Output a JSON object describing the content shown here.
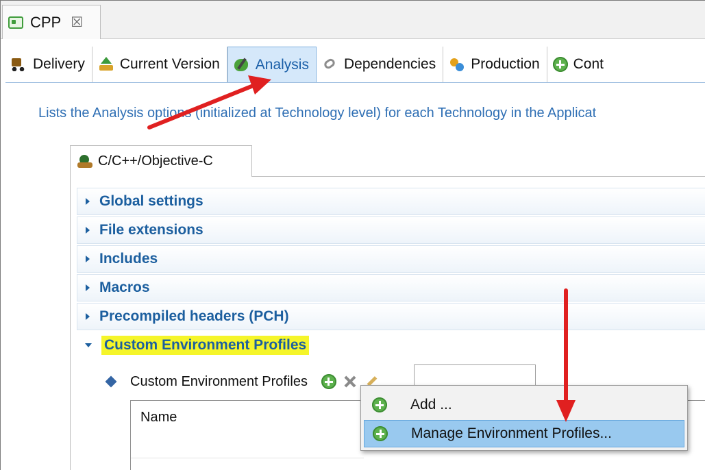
{
  "editor": {
    "tab_title": "CPP",
    "close_glyph": "☒"
  },
  "page_tabs": [
    {
      "label": "Delivery",
      "icon": "delivery-truck-icon",
      "active": false
    },
    {
      "label": "Current Version",
      "icon": "upload-arrow-icon",
      "active": false
    },
    {
      "label": "Analysis",
      "icon": "analysis-icon",
      "active": true
    },
    {
      "label": "Dependencies",
      "icon": "dependencies-link-icon",
      "active": false
    },
    {
      "label": "Production",
      "icon": "production-gears-icon",
      "active": false
    },
    {
      "label": "Cont",
      "icon": "add-circle-icon",
      "active": false
    }
  ],
  "description": "Lists the Analysis options (initialized at Technology level) for each Technology in the Applicat",
  "technology_tab": {
    "label": "C/C++/Objective-C",
    "icon": "technology-icon"
  },
  "sections": [
    {
      "label": "Global settings",
      "expanded": false
    },
    {
      "label": "File extensions",
      "expanded": false
    },
    {
      "label": "Includes",
      "expanded": false
    },
    {
      "label": "Macros",
      "expanded": false
    },
    {
      "label": "Precompiled headers (PCH)",
      "expanded": false
    },
    {
      "label": "Custom Environment Profiles",
      "expanded": true,
      "highlighted": true
    }
  ],
  "profiles": {
    "row_label": "Custom Environment Profiles",
    "filter_value": "",
    "table_header": "Name"
  },
  "context_menu": {
    "items": [
      {
        "label": "Add ...",
        "selected": false
      },
      {
        "label": "Manage Environment Profiles...",
        "selected": true
      }
    ]
  },
  "colors": {
    "accent": "#1c5f9f",
    "highlight": "#f5f52a",
    "selection": "#99c9ef",
    "annotation_arrow": "#e02020"
  }
}
